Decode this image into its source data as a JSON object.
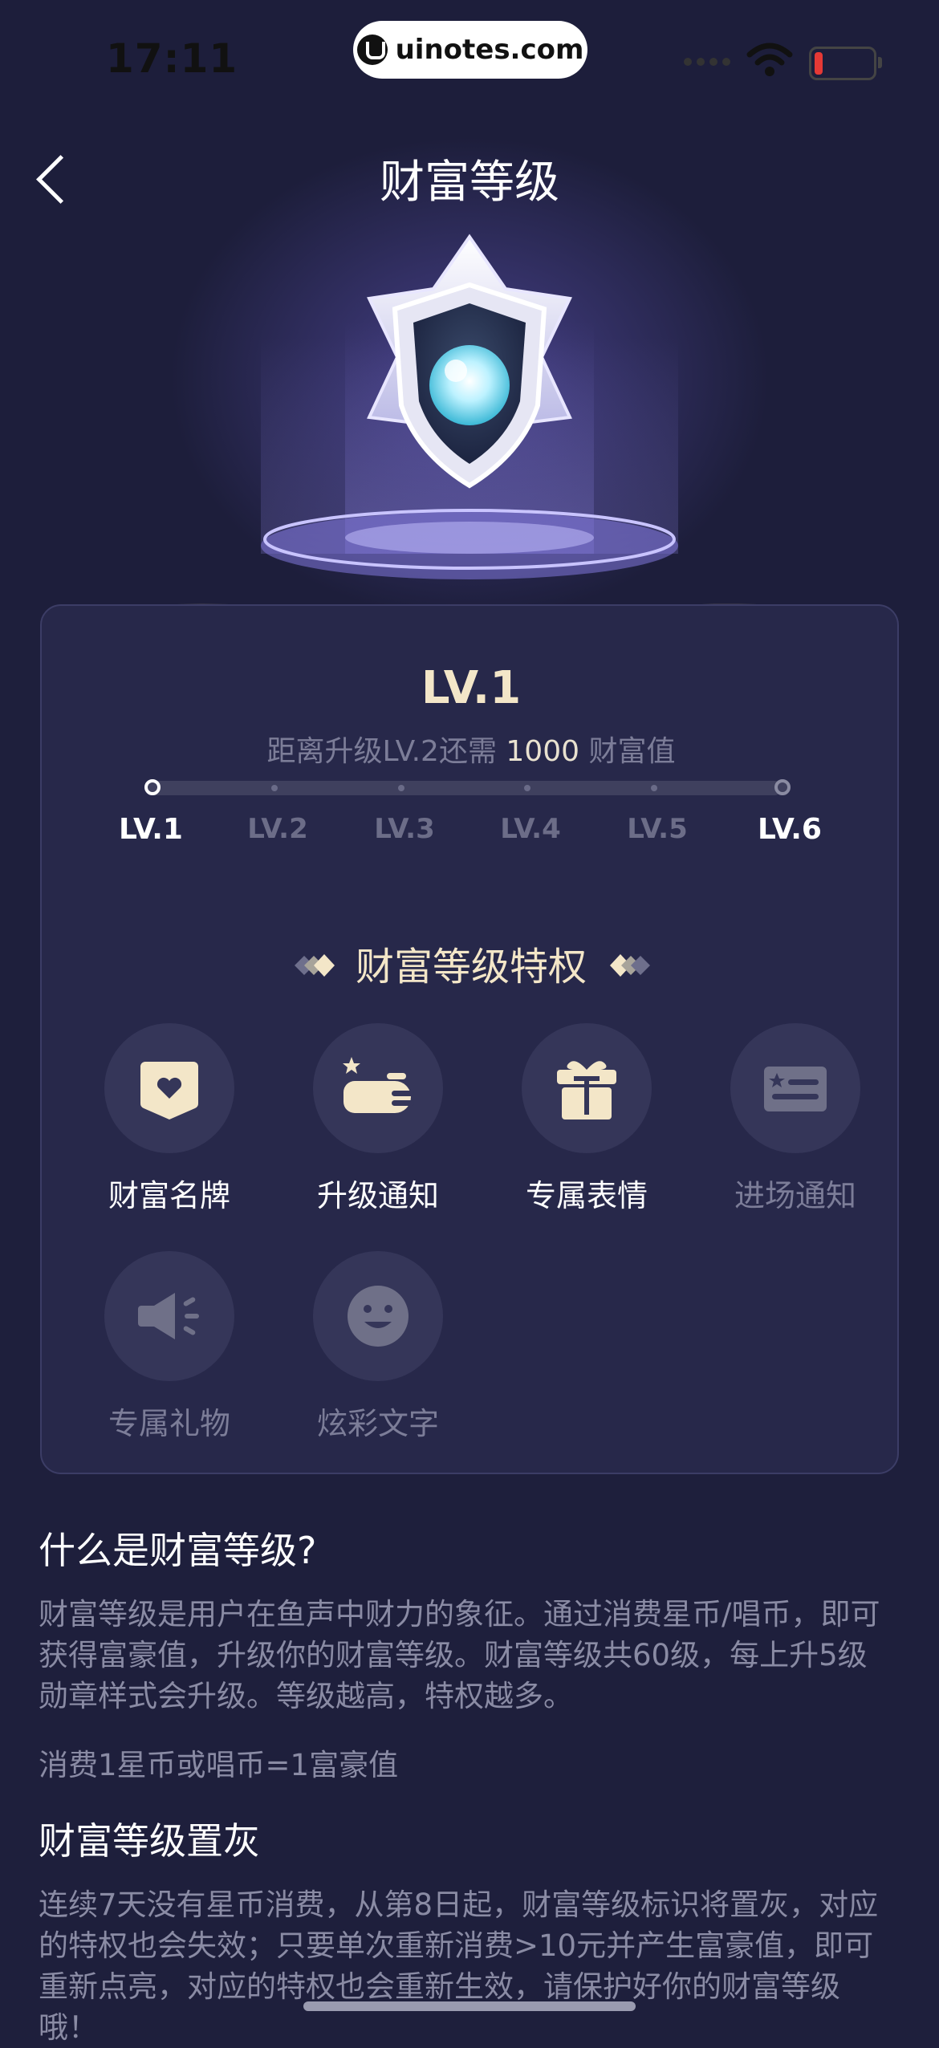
{
  "status_bar": {
    "time": "17:11",
    "watermark": "uinotes.com"
  },
  "nav": {
    "title": "财富等级"
  },
  "level": {
    "current": "LV.1",
    "progress_prefix": "距离升级LV.2还需 ",
    "progress_value": "1000",
    "progress_suffix": " 财富值",
    "milestones": [
      "LV.1",
      "LV.2",
      "LV.3",
      "LV.4",
      "LV.5",
      "LV.6"
    ]
  },
  "privileges": {
    "title": "财富等级特权",
    "items": [
      {
        "label": "财富名牌",
        "icon": "nameplate-icon",
        "active": true
      },
      {
        "label": "升级通知",
        "icon": "upgrade-notice-icon",
        "active": true
      },
      {
        "label": "专属表情",
        "icon": "gift-box-icon",
        "active": true
      },
      {
        "label": "进场通知",
        "icon": "entry-card-icon",
        "active": false
      },
      {
        "label": "专属礼物",
        "icon": "megaphone-icon",
        "active": false
      },
      {
        "label": "炫彩文字",
        "icon": "smiley-icon",
        "active": false
      }
    ]
  },
  "info": {
    "q1": "什么是财富等级?",
    "a1": "财富等级是用户在鱼声中财力的象征。通过消费星币/唱币，即可获得富豪值，升级你的财富等级。财富等级共60级，每上升5级勋章样式会升级。等级越高，特权越多。",
    "rate": "消费1星币或唱币=1富豪值",
    "q2": "财富等级置灰",
    "a2": "连续7天没有星币消费，从第8日起，财富等级标识将置灰，对应的特权也会失效；只要单次重新消费>10元并产生富豪值，即可重新点亮，对应的特权也会重新生效，请保护好你的财富等级哦！"
  },
  "colors": {
    "background": "#1e1f3c",
    "card": "#27284a",
    "accent_gold": "#f3e6c8",
    "muted": "#7c7d98"
  }
}
